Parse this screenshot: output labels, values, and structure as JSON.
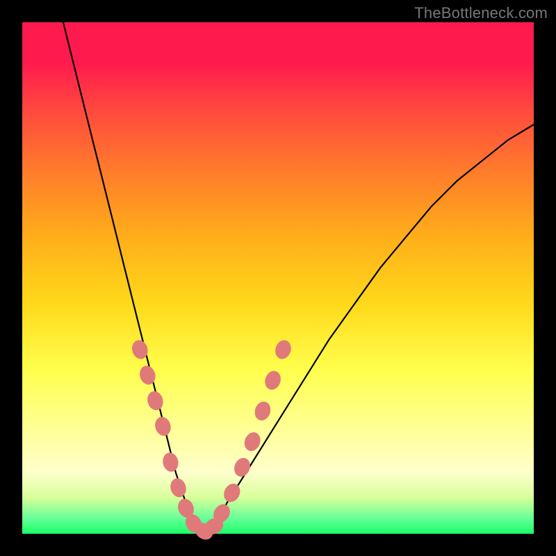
{
  "watermark": "TheBottleneck.com",
  "colors": {
    "bead": "#e07a7a",
    "line": "#000000",
    "gradient_top": "#ff1a4d",
    "gradient_bottom": "#1aff66"
  },
  "chart_data": {
    "type": "line",
    "title": "",
    "xlabel": "",
    "ylabel": "",
    "xlim": [
      0,
      100
    ],
    "ylim": [
      0,
      100
    ],
    "series": [
      {
        "name": "bottleneck-curve",
        "x": [
          8,
          10,
          12,
          14,
          16,
          18,
          20,
          22,
          24,
          26,
          28,
          30,
          32,
          34,
          36,
          38,
          40,
          45,
          50,
          55,
          60,
          65,
          70,
          75,
          80,
          85,
          90,
          95,
          100
        ],
        "y": [
          100,
          92,
          84,
          76,
          68,
          60,
          52,
          44,
          36,
          28,
          20,
          12,
          6,
          2,
          0,
          2,
          6,
          14,
          22,
          30,
          38,
          45,
          52,
          58,
          64,
          69,
          73,
          77,
          80
        ]
      }
    ],
    "annotations": {
      "bead_points": [
        {
          "x": 23,
          "y": 36
        },
        {
          "x": 24.5,
          "y": 31
        },
        {
          "x": 26,
          "y": 26
        },
        {
          "x": 27.5,
          "y": 21
        },
        {
          "x": 29,
          "y": 14
        },
        {
          "x": 30.5,
          "y": 9
        },
        {
          "x": 32,
          "y": 5
        },
        {
          "x": 33.5,
          "y": 2
        },
        {
          "x": 35.5,
          "y": 0.5
        },
        {
          "x": 37.5,
          "y": 1.5
        },
        {
          "x": 39,
          "y": 4
        },
        {
          "x": 41,
          "y": 8
        },
        {
          "x": 43,
          "y": 13
        },
        {
          "x": 45,
          "y": 18
        },
        {
          "x": 47,
          "y": 24
        },
        {
          "x": 49,
          "y": 30
        },
        {
          "x": 51,
          "y": 36
        }
      ]
    }
  }
}
